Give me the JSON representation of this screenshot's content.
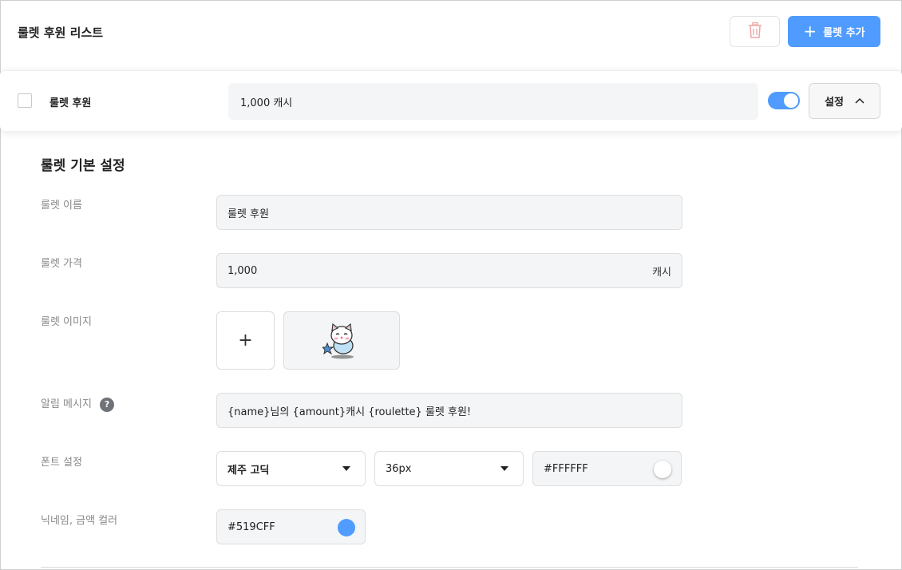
{
  "header": {
    "title": "룰렛 후원 리스트",
    "delete_icon": "trash-icon",
    "add_button_label": "룰렛 추가"
  },
  "roulette_row": {
    "name": "룰렛 후원",
    "price": "1,000 캐시",
    "enabled": true,
    "settings_label": "설정",
    "settings_icon": "chevron-up-icon"
  },
  "section": {
    "title": "룰렛 기본 설정",
    "name_label": "룰렛 이름",
    "name_value": "룰렛 후원",
    "price_label": "룰렛 가격",
    "price_value": "1,000",
    "price_unit": "캐시",
    "image_label": "룰렛 이미지",
    "image_add_glyph": "+",
    "alert_label": "알림 메시지",
    "alert_help_glyph": "?",
    "alert_value": "{name}님의 {amount}캐시 {roulette} 룰렛 후원!",
    "font_label": "폰트 설정",
    "font_family_value": "제주 고딕",
    "font_size_value": "36px",
    "font_color_value": "#FFFFFF",
    "nick_color_label": "닉네임, 금액 컬러",
    "nick_color_value": "#519CFF"
  },
  "colors": {
    "accent": "#4f9bff",
    "delete_icon": "#f0a5a5",
    "font_color_swatch": "#FFFFFF",
    "nick_color_swatch": "#519CFF"
  }
}
